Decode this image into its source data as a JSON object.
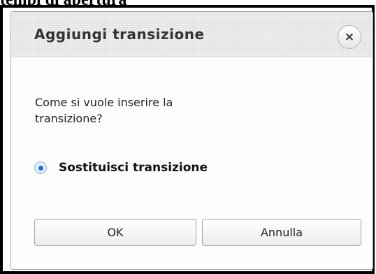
{
  "document": {
    "heading": "tempi di apertura"
  },
  "dialog": {
    "title": "Aggiungi transizione",
    "close_icon": "close-icon",
    "question": "Come si vuole inserire la transizione?",
    "option": {
      "label": "Sostituisci transizione",
      "selected": true
    },
    "buttons": {
      "ok_label": "OK",
      "cancel_label": "Annulla"
    }
  }
}
